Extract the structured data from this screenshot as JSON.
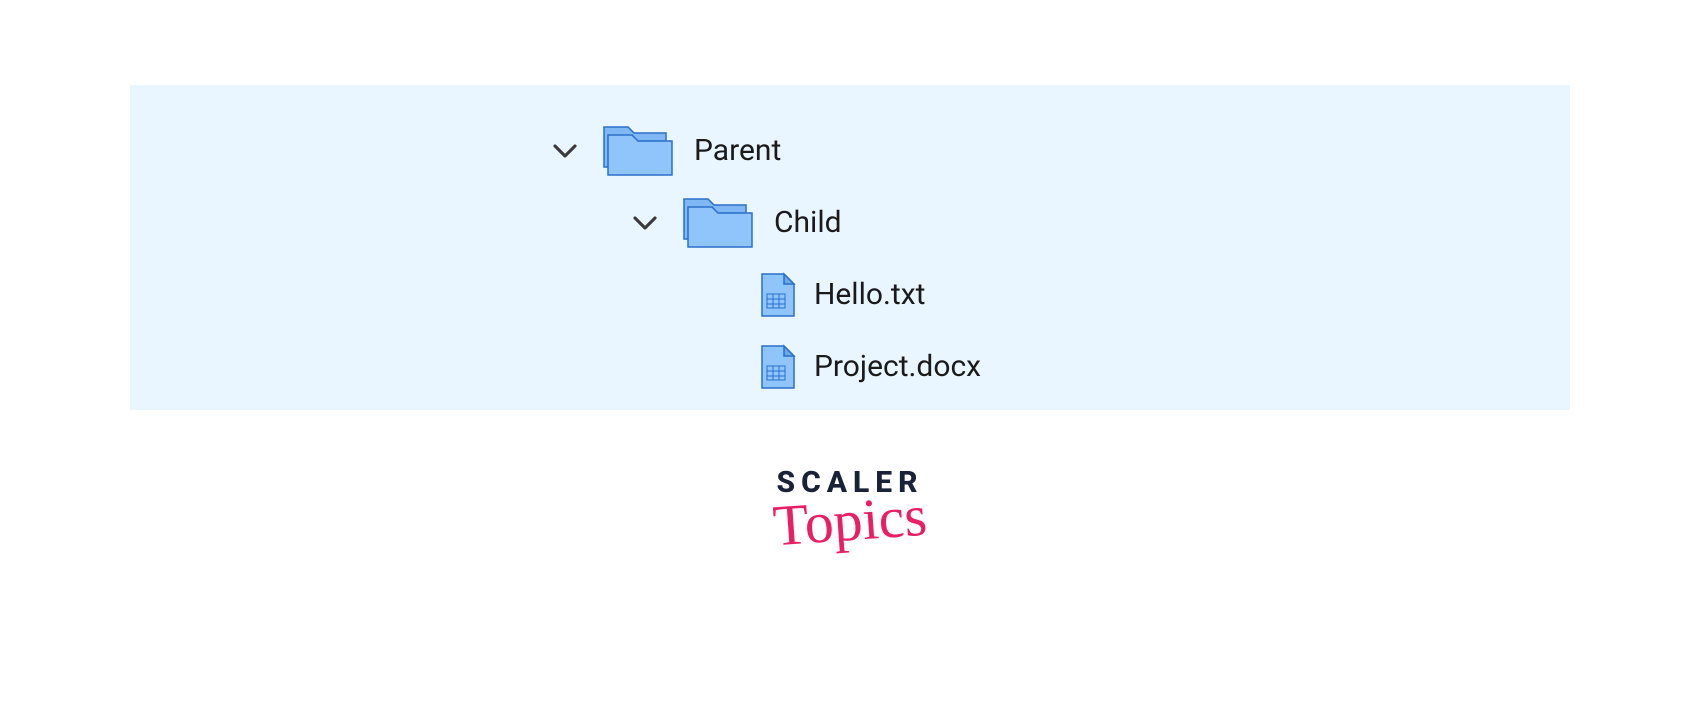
{
  "tree": {
    "root": {
      "label": "Parent",
      "children": [
        {
          "label": "Child",
          "files": [
            {
              "label": "Hello.txt"
            },
            {
              "label": "Project.docx"
            }
          ]
        }
      ]
    }
  },
  "logo": {
    "line1": "SCALER",
    "line2": "Topics"
  },
  "icons": {
    "chevron": "chevron-down-icon",
    "folder": "folder-icon",
    "file": "file-icon"
  }
}
